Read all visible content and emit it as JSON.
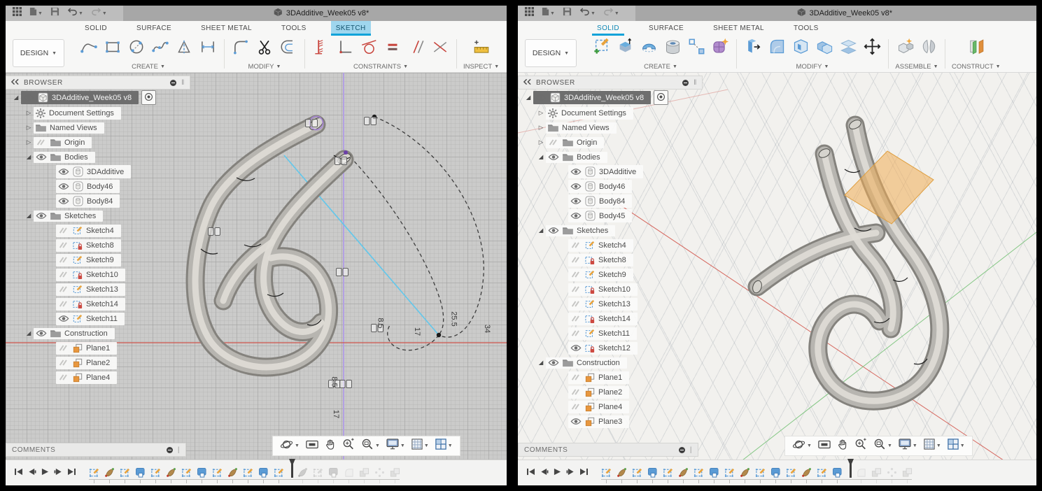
{
  "app": {
    "accent_blue": "#12a3d9",
    "sketch_tab_bg": "#9fd6ee",
    "locked_red": "#cd4a42",
    "plane_orange": "#e8973f",
    "axis_red": "#d6675e",
    "axis_green": "#85c785",
    "axis_purple": "#b3a0e2"
  },
  "windows": [
    {
      "titlebar": {
        "title": "3DAdditive_Week05 v8*"
      },
      "qat": [
        "app-grid",
        "file-new",
        "save",
        "undo",
        "redo"
      ],
      "design_menu": {
        "label": "DESIGN"
      },
      "tabs": [
        {
          "label": "SOLID",
          "active": false
        },
        {
          "label": "SURFACE",
          "active": false
        },
        {
          "label": "SHEET METAL",
          "active": false
        },
        {
          "label": "TOOLS",
          "active": false
        },
        {
          "label": "SKETCH",
          "active": true,
          "filled": true
        }
      ],
      "toolbar_groups": [
        {
          "label": "CREATE",
          "icons": [
            "line-tool",
            "rectangle-tool",
            "circle-tool",
            "spline-tool",
            "mirror-tool",
            "dimension-tool"
          ]
        },
        {
          "label": "MODIFY",
          "icons": [
            "fillet-tool",
            "trim-tool",
            "offset-tool"
          ]
        },
        {
          "label": "CONSTRAINTS",
          "icons": [
            "fix-constraint",
            "perpendicular-constraint",
            "tangent-constraint",
            "equal-constraint",
            "parallel-constraint",
            "symmetry-constraint"
          ]
        },
        {
          "label": "INSPECT",
          "icons": [
            "measure-tool"
          ]
        }
      ],
      "browser": {
        "header": "BROWSER",
        "root": {
          "label": "3DAdditive_Week05 v8",
          "selected": true
        },
        "items": [
          {
            "label": "Document Settings",
            "icon": "gear",
            "expand": "collapsed",
            "eye": null,
            "indent": 1
          },
          {
            "label": "Named Views",
            "icon": "folder",
            "expand": "collapsed",
            "eye": null,
            "indent": 1
          },
          {
            "label": "Origin",
            "icon": "folder",
            "expand": "collapsed",
            "eye": "hidden",
            "indent": 1
          },
          {
            "label": "Bodies",
            "icon": "folder",
            "expand": "expanded",
            "eye": "visible",
            "indent": 1
          },
          {
            "label": "3DAdditive",
            "icon": "body",
            "expand": null,
            "eye": "visible",
            "indent": 2
          },
          {
            "label": "Body46",
            "icon": "body",
            "expand": null,
            "eye": "visible",
            "indent": 2
          },
          {
            "label": "Body84",
            "icon": "body",
            "expand": null,
            "eye": "visible",
            "indent": 2
          },
          {
            "label": "Sketches",
            "icon": "folder",
            "expand": "expanded",
            "eye": "visible",
            "indent": 1
          },
          {
            "label": "Sketch4",
            "icon": "sketch",
            "expand": null,
            "eye": "hidden",
            "indent": 2
          },
          {
            "label": "Sketch8",
            "icon": "sketch-locked",
            "expand": null,
            "eye": "hidden",
            "indent": 2
          },
          {
            "label": "Sketch9",
            "icon": "sketch",
            "expand": null,
            "eye": "hidden",
            "indent": 2
          },
          {
            "label": "Sketch10",
            "icon": "sketch-locked",
            "expand": null,
            "eye": "hidden",
            "indent": 2
          },
          {
            "label": "Sketch13",
            "icon": "sketch",
            "expand": null,
            "eye": "hidden",
            "indent": 2
          },
          {
            "label": "Sketch14",
            "icon": "sketch-locked",
            "expand": null,
            "eye": "hidden",
            "indent": 2
          },
          {
            "label": "Sketch11",
            "icon": "sketch",
            "expand": null,
            "eye": "visible",
            "indent": 2
          },
          {
            "label": "Construction",
            "icon": "folder",
            "expand": "expanded",
            "eye": "visible",
            "indent": 1
          },
          {
            "label": "Plane1",
            "icon": "plane",
            "expand": null,
            "eye": "hidden",
            "indent": 2
          },
          {
            "label": "Plane2",
            "icon": "plane",
            "expand": null,
            "eye": "hidden",
            "indent": 2
          },
          {
            "label": "Plane4",
            "icon": "plane",
            "expand": null,
            "eye": "hidden",
            "indent": 2
          }
        ]
      },
      "comments": {
        "label": "COMMENTS"
      },
      "view_controls": [
        "orbit",
        "look-at",
        "pan",
        "zoom",
        "zoom-window",
        "display-settings",
        "grid-settings",
        "viewports"
      ],
      "timeline": {
        "playback": [
          "go-to-start",
          "step-back",
          "play",
          "step-forward",
          "go-to-end"
        ],
        "marker_index": 13,
        "features": [
          {
            "type": "sketch",
            "suppressed": false
          },
          {
            "type": "sweep",
            "suppressed": false
          },
          {
            "type": "sketch",
            "suppressed": false
          },
          {
            "type": "pipe",
            "suppressed": false
          },
          {
            "type": "sketch",
            "suppressed": false
          },
          {
            "type": "sweep",
            "suppressed": false
          },
          {
            "type": "sketch",
            "suppressed": false
          },
          {
            "type": "pipe",
            "suppressed": false
          },
          {
            "type": "sketch",
            "suppressed": false
          },
          {
            "type": "sweep",
            "suppressed": false
          },
          {
            "type": "sketch",
            "suppressed": false
          },
          {
            "type": "pipe",
            "suppressed": false
          },
          {
            "type": "sketch",
            "suppressed": false
          },
          {
            "type": "sweep",
            "suppressed": true
          },
          {
            "type": "sketch",
            "suppressed": true
          },
          {
            "type": "pipe",
            "suppressed": true
          },
          {
            "type": "fillet",
            "suppressed": true
          },
          {
            "type": "move-copy",
            "suppressed": true
          },
          {
            "type": "circular-pattern",
            "suppressed": true
          },
          {
            "type": "move-copy",
            "suppressed": true
          }
        ]
      },
      "canvas": {
        "dimension_labels": [
          "8.5",
          "17",
          "25.5",
          "34",
          "8.5",
          "17"
        ]
      }
    },
    {
      "titlebar": {
        "title": "3DAdditive_Week05 v8*"
      },
      "qat": [
        "app-grid",
        "file-new",
        "save",
        "undo",
        "redo"
      ],
      "design_menu": {
        "label": "DESIGN"
      },
      "tabs": [
        {
          "label": "SOLID",
          "active": true,
          "filled": false
        },
        {
          "label": "SURFACE",
          "active": false
        },
        {
          "label": "SHEET METAL",
          "active": false
        },
        {
          "label": "TOOLS",
          "active": false
        }
      ],
      "toolbar_groups": [
        {
          "label": "CREATE",
          "icons": [
            "create-sketch",
            "extrude",
            "revolve",
            "hole",
            "pattern",
            "create-form"
          ]
        },
        {
          "label": "MODIFY",
          "icons": [
            "press-pull",
            "fillet-3d",
            "shell",
            "combine",
            "offset-face",
            "move"
          ]
        },
        {
          "label": "ASSEMBLE",
          "icons": [
            "new-component",
            "joint"
          ]
        },
        {
          "label": "CONSTRUCT",
          "icons": [
            "construct-plane"
          ]
        }
      ],
      "browser": {
        "header": "BROWSER",
        "root": {
          "label": "3DAdditive_Week05 v8",
          "selected": true
        },
        "items": [
          {
            "label": "Document Settings",
            "icon": "gear",
            "expand": "collapsed",
            "eye": null,
            "indent": 1
          },
          {
            "label": "Named Views",
            "icon": "folder",
            "expand": "collapsed",
            "eye": null,
            "indent": 1
          },
          {
            "label": "Origin",
            "icon": "folder",
            "expand": "collapsed",
            "eye": "hidden",
            "indent": 1
          },
          {
            "label": "Bodies",
            "icon": "folder",
            "expand": "expanded",
            "eye": "visible",
            "indent": 1
          },
          {
            "label": "3DAdditive",
            "icon": "body",
            "expand": null,
            "eye": "visible",
            "indent": 2
          },
          {
            "label": "Body46",
            "icon": "body",
            "expand": null,
            "eye": "visible",
            "indent": 2
          },
          {
            "label": "Body84",
            "icon": "body",
            "expand": null,
            "eye": "visible",
            "indent": 2
          },
          {
            "label": "Body45",
            "icon": "body",
            "expand": null,
            "eye": "visible",
            "indent": 2
          },
          {
            "label": "Sketches",
            "icon": "folder",
            "expand": "expanded",
            "eye": "visible",
            "indent": 1
          },
          {
            "label": "Sketch4",
            "icon": "sketch",
            "expand": null,
            "eye": "hidden",
            "indent": 2
          },
          {
            "label": "Sketch8",
            "icon": "sketch-locked",
            "expand": null,
            "eye": "hidden",
            "indent": 2
          },
          {
            "label": "Sketch9",
            "icon": "sketch",
            "expand": null,
            "eye": "hidden",
            "indent": 2
          },
          {
            "label": "Sketch10",
            "icon": "sketch-locked",
            "expand": null,
            "eye": "hidden",
            "indent": 2
          },
          {
            "label": "Sketch13",
            "icon": "sketch",
            "expand": null,
            "eye": "hidden",
            "indent": 2
          },
          {
            "label": "Sketch14",
            "icon": "sketch-locked",
            "expand": null,
            "eye": "hidden",
            "indent": 2
          },
          {
            "label": "Sketch11",
            "icon": "sketch",
            "expand": null,
            "eye": "hidden",
            "indent": 2
          },
          {
            "label": "Sketch12",
            "icon": "sketch-locked",
            "expand": null,
            "eye": "visible",
            "indent": 2
          },
          {
            "label": "Construction",
            "icon": "folder",
            "expand": "expanded",
            "eye": "visible",
            "indent": 1
          },
          {
            "label": "Plane1",
            "icon": "plane",
            "expand": null,
            "eye": "hidden",
            "indent": 2
          },
          {
            "label": "Plane2",
            "icon": "plane",
            "expand": null,
            "eye": "hidden",
            "indent": 2
          },
          {
            "label": "Plane4",
            "icon": "plane",
            "expand": null,
            "eye": "hidden",
            "indent": 2
          },
          {
            "label": "Plane3",
            "icon": "plane",
            "expand": null,
            "eye": "visible",
            "indent": 2
          }
        ]
      },
      "comments": {
        "label": "COMMENTS"
      },
      "view_controls": [
        "orbit",
        "look-at",
        "pan",
        "zoom",
        "zoom-window",
        "display-settings",
        "grid-settings",
        "viewports"
      ],
      "timeline": {
        "playback": [
          "go-to-start",
          "step-back",
          "play",
          "step-forward",
          "go-to-end"
        ],
        "marker_index": 16,
        "features": [
          {
            "type": "sketch",
            "suppressed": false
          },
          {
            "type": "sweep",
            "suppressed": false
          },
          {
            "type": "sketch",
            "suppressed": false
          },
          {
            "type": "pipe",
            "suppressed": false
          },
          {
            "type": "sketch",
            "suppressed": false
          },
          {
            "type": "sweep",
            "suppressed": false
          },
          {
            "type": "sketch",
            "suppressed": false
          },
          {
            "type": "pipe",
            "suppressed": false
          },
          {
            "type": "sketch",
            "suppressed": false
          },
          {
            "type": "sweep",
            "suppressed": false
          },
          {
            "type": "sketch",
            "suppressed": false
          },
          {
            "type": "pipe",
            "suppressed": false
          },
          {
            "type": "sketch",
            "suppressed": false
          },
          {
            "type": "sweep",
            "suppressed": false
          },
          {
            "type": "sketch",
            "suppressed": false
          },
          {
            "type": "pipe",
            "suppressed": false
          },
          {
            "type": "fillet",
            "suppressed": true
          },
          {
            "type": "move-copy",
            "suppressed": true
          },
          {
            "type": "circular-pattern",
            "suppressed": true
          },
          {
            "type": "move-copy",
            "suppressed": true
          }
        ]
      },
      "canvas": {
        "dimension_labels": []
      }
    }
  ]
}
